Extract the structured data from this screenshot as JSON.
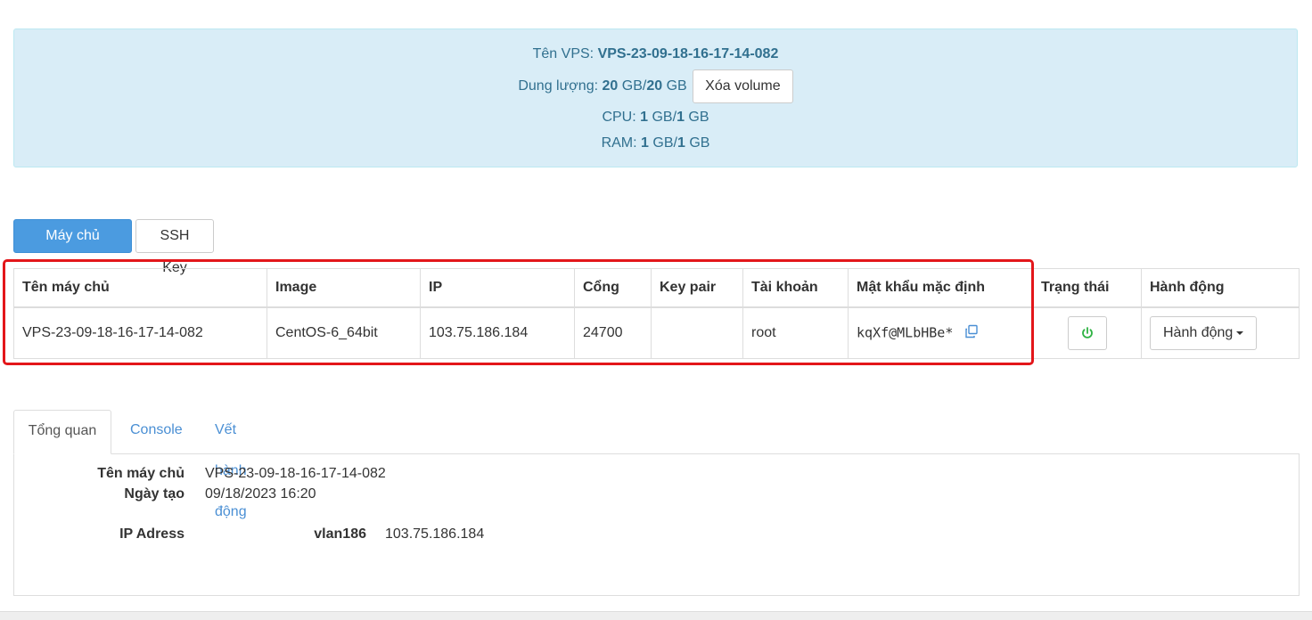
{
  "info": {
    "vps_name_label": "Tên VPS:",
    "vps_name_value": "VPS-23-09-18-16-17-14-082",
    "storage_label": "Dung lượng:",
    "storage_used": "20",
    "storage_unit": "GB",
    "storage_total": "20",
    "delete_volume_button": "Xóa volume",
    "cpu_label": "CPU:",
    "cpu_used": "1",
    "cpu_unit": "GB",
    "cpu_total": "1",
    "ram_label": "RAM:",
    "ram_used": "1",
    "ram_unit": "GB",
    "ram_total": "1"
  },
  "tabs": {
    "cloud_server": "Máy chủ Cloud",
    "ssh_key": "SSH Key"
  },
  "table": {
    "headers": [
      "Tên máy chủ",
      "Image",
      "IP",
      "Cổng",
      "Key pair",
      "Tài khoản",
      "Mật khẩu mặc định",
      "Trạng thái",
      "Hành động"
    ],
    "rows": [
      {
        "name": "VPS-23-09-18-16-17-14-082",
        "image": "CentOS-6_64bit",
        "ip": "103.75.186.184",
        "port": "24700",
        "key_pair": "",
        "account": "root",
        "password": "kqXf@MLbHBe*",
        "status": "running",
        "action_label": "Hành động"
      }
    ]
  },
  "detail_tabs": {
    "overview": "Tổng quan",
    "console": "Console",
    "activity": "Vết hành động"
  },
  "overview": {
    "server_name_label": "Tên máy chủ",
    "server_name_value": "VPS-23-09-18-16-17-14-082",
    "created_label": "Ngày tạo",
    "created_value": "09/18/2023 16:20",
    "ip_label": "IP Adress",
    "network_name": "vlan186",
    "ip_value": "103.75.186.184"
  },
  "colors": {
    "info_bg": "#d9edf7",
    "info_text": "#31708f",
    "primary": "#4b9be0",
    "highlight": "#e3161a",
    "status_on": "#2fb344",
    "link": "#4a8fd4"
  }
}
